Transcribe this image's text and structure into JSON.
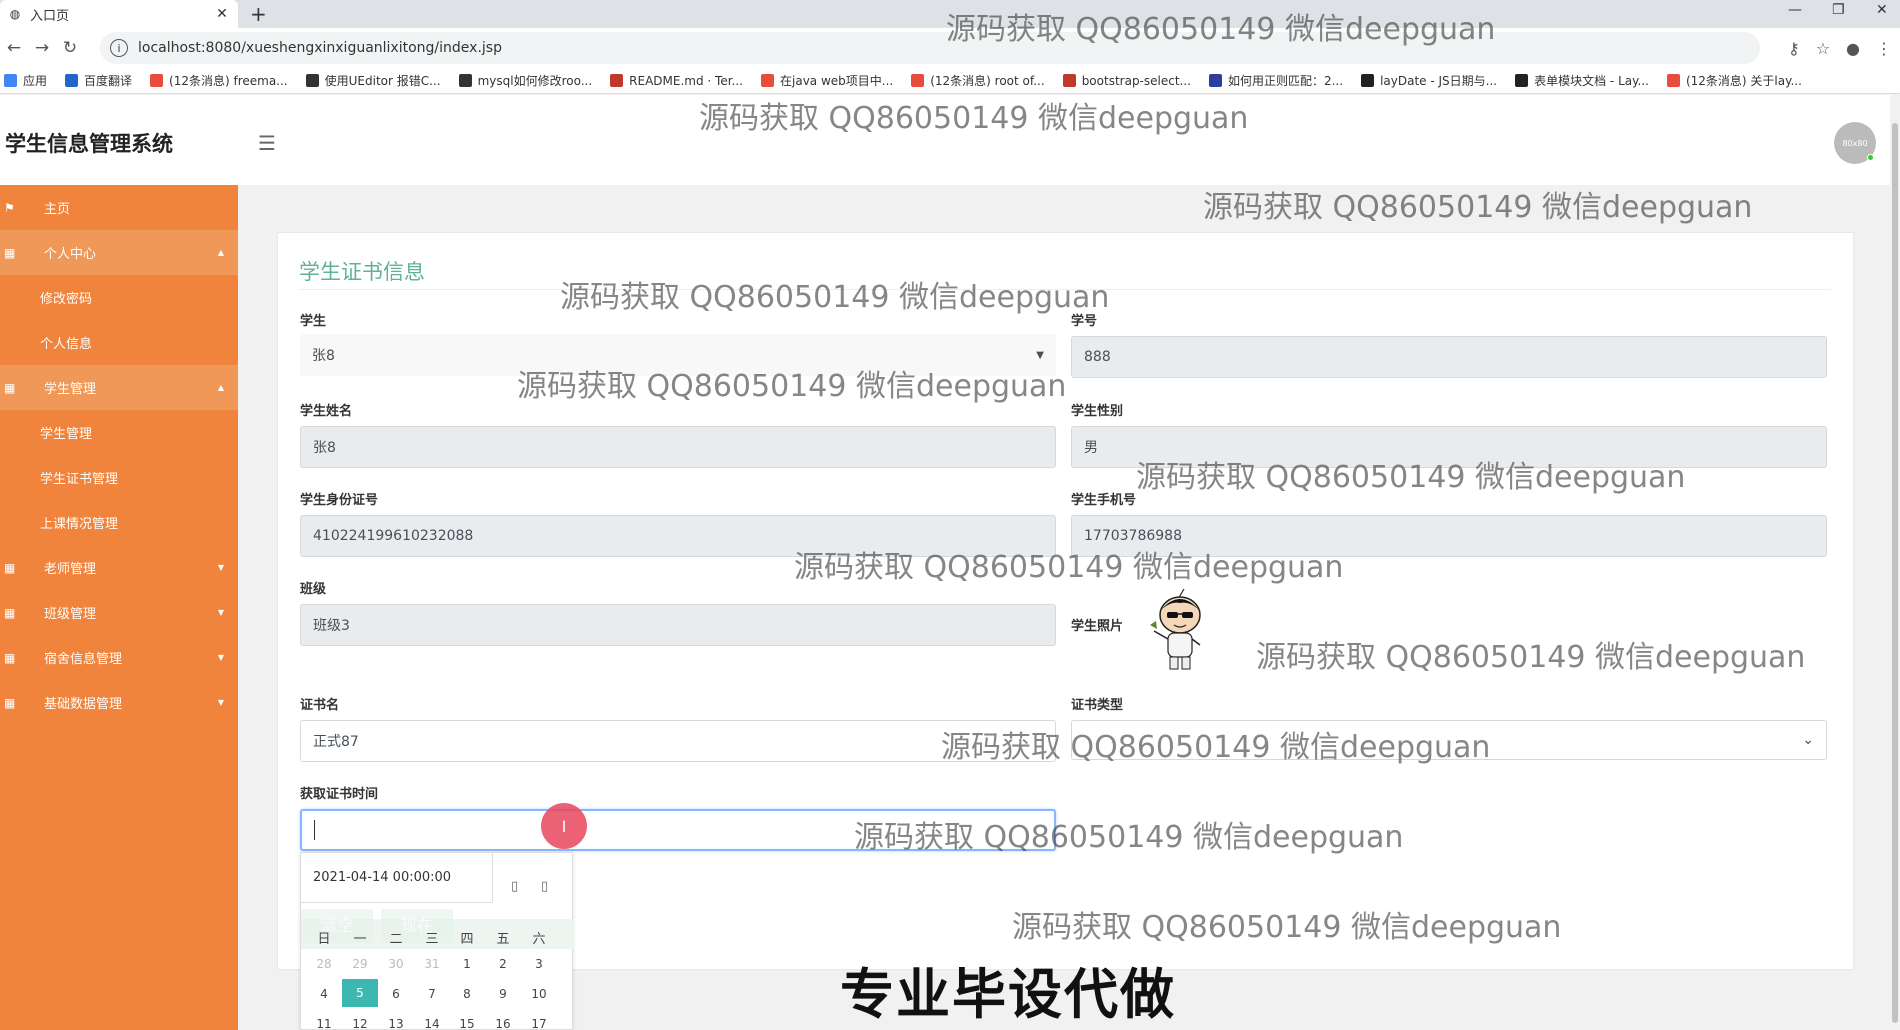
{
  "browser": {
    "tab_title": "入口页",
    "url": "localhost:8080/xueshengxinxiguanlixitong/index.jsp",
    "bookmarks": [
      {
        "label": "应用",
        "color": "#4285f4"
      },
      {
        "label": "百度翻译",
        "color": "#2266cc"
      },
      {
        "label": "(12条消息) freema...",
        "color": "#e74c3c"
      },
      {
        "label": "使用UEditor 报错C...",
        "color": "#333333"
      },
      {
        "label": "mysql如何修改roo...",
        "color": "#333333"
      },
      {
        "label": "README.md · Ter...",
        "color": "#c0392b"
      },
      {
        "label": "在java web项目中...",
        "color": "#e74c3c"
      },
      {
        "label": "(12条消息) root of...",
        "color": "#e74c3c"
      },
      {
        "label": "bootstrap-select...",
        "color": "#c0392b"
      },
      {
        "label": "如何用正则匹配：2...",
        "color": "#2c3e9e"
      },
      {
        "label": "layDate - JS日期与...",
        "color": "#222222"
      },
      {
        "label": "表单模块文档 - Lay...",
        "color": "#222222"
      },
      {
        "label": "(12条消息) 关于lay...",
        "color": "#e74c3c"
      }
    ]
  },
  "app": {
    "title": "学生信息管理系统",
    "avatar_text": "80x80"
  },
  "sidebar": {
    "items": [
      {
        "label": "主页",
        "kind": "top",
        "icon": "flag-icon"
      },
      {
        "label": "个人中心",
        "kind": "group",
        "icon": "grid-icon",
        "arrow": "▲"
      },
      {
        "label": "修改密码",
        "kind": "sub"
      },
      {
        "label": "个人信息",
        "kind": "sub"
      },
      {
        "label": "学生管理",
        "kind": "group",
        "icon": "grid-icon",
        "arrow": "▲"
      },
      {
        "label": "学生管理",
        "kind": "sub"
      },
      {
        "label": "学生证书管理",
        "kind": "sub"
      },
      {
        "label": "上课情况管理",
        "kind": "sub"
      },
      {
        "label": "老师管理",
        "kind": "top",
        "icon": "grid-icon",
        "arrow": "▼"
      },
      {
        "label": "班级管理",
        "kind": "top",
        "icon": "grid-icon",
        "arrow": "▼"
      },
      {
        "label": "宿舍信息管理",
        "kind": "top",
        "icon": "grid-icon",
        "arrow": "▼"
      },
      {
        "label": "基础数据管理",
        "kind": "top",
        "icon": "grid-icon",
        "arrow": "▼"
      }
    ]
  },
  "form": {
    "title": "学生证书信息",
    "student_label": "学生",
    "student_value": "张8",
    "student_no_label": "学号",
    "student_no_value": "888",
    "name_label": "学生姓名",
    "name_value": "张8",
    "gender_label": "学生性别",
    "gender_value": "男",
    "id_label": "学生身份证号",
    "id_value": "410224199610232088",
    "phone_label": "学生手机号",
    "phone_value": "17703786988",
    "class_label": "班级",
    "class_value": "班级3",
    "photo_label": "学生照片",
    "cert_name_label": "证书名",
    "cert_name_value": "正式87",
    "cert_type_label": "证书类型",
    "cert_type_value": "",
    "cert_time_label": "获取证书时间",
    "cert_time_value": ""
  },
  "datepicker": {
    "value": "2021-04-14 00:00:00",
    "buttons": [
      "清空",
      "现在"
    ],
    "weekdays": [
      "日",
      "一",
      "二",
      "三",
      "四",
      "五",
      "六"
    ],
    "rows": [
      [
        "28",
        "29",
        "30",
        "31",
        "1",
        "2",
        "3"
      ],
      [
        "4",
        "5",
        "6",
        "7",
        "8",
        "9",
        "10"
      ],
      [
        "11",
        "12",
        "13",
        "14",
        "15",
        "16",
        "17"
      ]
    ],
    "muted": [
      "28",
      "29",
      "30",
      "31"
    ],
    "selected": "5"
  },
  "watermark": "源码获取 QQ86050149 微信deepguan",
  "slogan": "专业毕设代做"
}
